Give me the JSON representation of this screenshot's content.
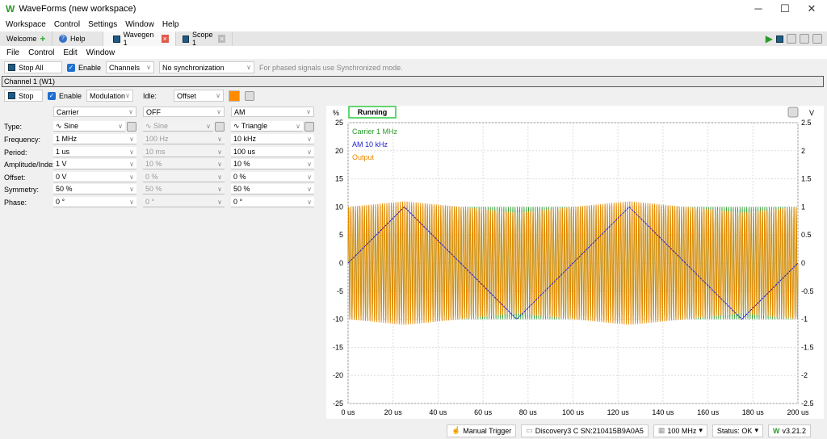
{
  "window": {
    "title": "WaveForms (new workspace)",
    "logo": "W",
    "minimize": "─",
    "maximize": "☐",
    "close": "✕"
  },
  "menu": [
    "Workspace",
    "Control",
    "Settings",
    "Window",
    "Help"
  ],
  "tabs": [
    {
      "label": "Welcome",
      "icon": "plus-icon"
    },
    {
      "label": "Help",
      "icon": "help-icon"
    },
    {
      "label": "Wavegen 1",
      "icon": "wavegen-icon",
      "active": true
    },
    {
      "label": "Scope 1",
      "icon": "scope-icon"
    }
  ],
  "submenu": [
    "File",
    "Control",
    "Edit",
    "Window"
  ],
  "toolbar": {
    "stop_all": "Stop All",
    "enable": "Enable",
    "channels": "Channels",
    "sync": "No synchronization",
    "hint": "For phased signals use Synchronized mode."
  },
  "channel": {
    "header": "Channel 1 (W1)",
    "stop": "Stop",
    "enable": "Enable",
    "mode": "Modulation",
    "idle_label": "Idle:",
    "idle": "Offset",
    "color": "#ff8c00"
  },
  "params": {
    "labels": [
      "Type:",
      "Frequency:",
      "Period:",
      "Amplitude/Index:",
      "Offset:",
      "Symmetry:",
      "Phase:"
    ],
    "columns": [
      {
        "header": "Carrier",
        "disabled": false,
        "values": [
          "Sine",
          "1 MHz",
          "1 us",
          "1 V",
          "0 V",
          "50 %",
          "0 °"
        ]
      },
      {
        "header": "OFF",
        "disabled": true,
        "values": [
          "Sine",
          "100 Hz",
          "10 ms",
          "10 %",
          "0 %",
          "50 %",
          "0 °"
        ]
      },
      {
        "header": "AM",
        "disabled": false,
        "values": [
          "Triangle",
          "10 kHz",
          "100 us",
          "10 %",
          "0 %",
          "50 %",
          "0 °"
        ]
      }
    ]
  },
  "plot": {
    "status": "Running",
    "left_unit": "%",
    "right_unit": "V"
  },
  "chart_data": {
    "type": "line",
    "xlabel": "",
    "xlim": [
      0,
      200
    ],
    "x_unit": "us",
    "x_ticks": [
      "0 us",
      "20 us",
      "40 us",
      "60 us",
      "80 us",
      "100 us",
      "120 us",
      "140 us",
      "160 us",
      "180 us",
      "200 us"
    ],
    "y_left": {
      "unit": "%",
      "lim": [
        -25,
        25
      ],
      "ticks": [
        "25",
        "20",
        "15",
        "10",
        "5",
        "0",
        "-5",
        "-10",
        "-15",
        "-20",
        "-25"
      ]
    },
    "y_right": {
      "unit": "V",
      "lim": [
        -2.5,
        2.5
      ],
      "ticks": [
        "2.5",
        "2",
        "1.5",
        "1",
        "0.5",
        "0",
        "-0.5",
        "-1",
        "-1.5",
        "-2",
        "-2.5"
      ]
    },
    "grid": true,
    "legend_placement": "top-left",
    "series": [
      {
        "name": "Carrier 1 MHz",
        "color": "#2a9a2a",
        "axis": "right",
        "waveform": "sine",
        "frequency_mhz": 1,
        "amplitude_v": 1
      },
      {
        "name": "AM 10 kHz",
        "color": "#2020d0",
        "axis": "left",
        "points": [
          [
            0,
            0
          ],
          [
            25,
            10
          ],
          [
            75,
            -10
          ],
          [
            125,
            10
          ],
          [
            175,
            -10
          ],
          [
            200,
            0
          ]
        ]
      },
      {
        "name": "Output",
        "color": "#e88a00",
        "axis": "right",
        "waveform": "sine 1 MHz AM by triangle 10 kHz, 10 %",
        "amplitude_v": 1
      }
    ]
  },
  "status": {
    "trigger": "Manual Trigger",
    "device": "Discovery3 C SN:210415B9A0A5",
    "clock": "100 MHz",
    "status": "Status: OK",
    "version": "v3.21.2"
  }
}
